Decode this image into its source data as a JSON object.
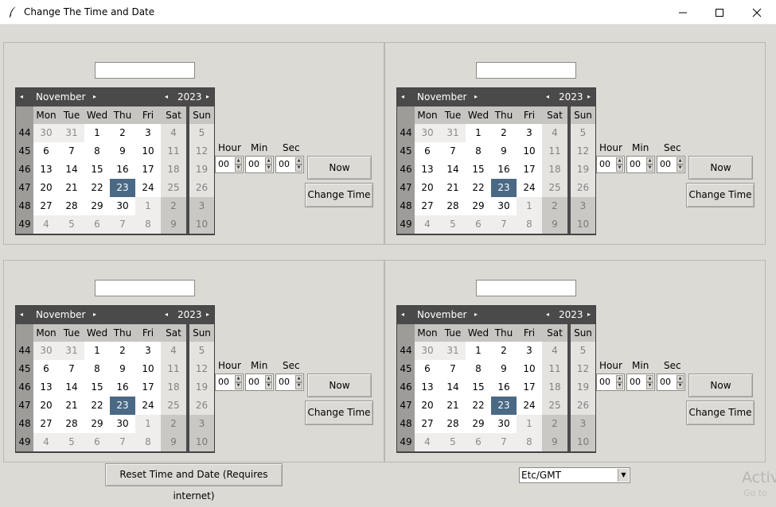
{
  "window": {
    "title": "Change The Time and Date",
    "icon": "feather-icon"
  },
  "calendar": {
    "month": "November",
    "year": "2023",
    "day_headers": [
      "Mon",
      "Tue",
      "Wed",
      "Thu",
      "Fri",
      "Sat",
      "Sun"
    ],
    "weeks": [
      {
        "num": "44",
        "days": [
          "30",
          "31",
          "1",
          "2",
          "3",
          "4",
          "5"
        ]
      },
      {
        "num": "45",
        "days": [
          "6",
          "7",
          "8",
          "9",
          "10",
          "11",
          "12"
        ]
      },
      {
        "num": "46",
        "days": [
          "13",
          "14",
          "15",
          "16",
          "17",
          "18",
          "19"
        ]
      },
      {
        "num": "47",
        "days": [
          "20",
          "21",
          "22",
          "23",
          "24",
          "25",
          "26"
        ]
      },
      {
        "num": "48",
        "days": [
          "27",
          "28",
          "29",
          "30",
          "1",
          "2",
          "3"
        ]
      },
      {
        "num": "49",
        "days": [
          "4",
          "5",
          "6",
          "7",
          "8",
          "9",
          "10"
        ]
      }
    ],
    "selected_day": "23"
  },
  "time": {
    "hour_label": "Hour",
    "min_label": "Min",
    "sec_label": "Sec",
    "hour": "00",
    "min": "00",
    "sec": "00"
  },
  "buttons": {
    "now": "Now",
    "change_time": "Change Time",
    "reset": "Reset Time and Date (Requires internet)"
  },
  "timezone": {
    "selected": "Etc/GMT"
  },
  "watermark": {
    "line1": "Activ",
    "line2": "Go to"
  },
  "colors": {
    "background": "#dcdad5",
    "calendar_header": "#4a4a4a",
    "selected_day": "#4a6984"
  }
}
